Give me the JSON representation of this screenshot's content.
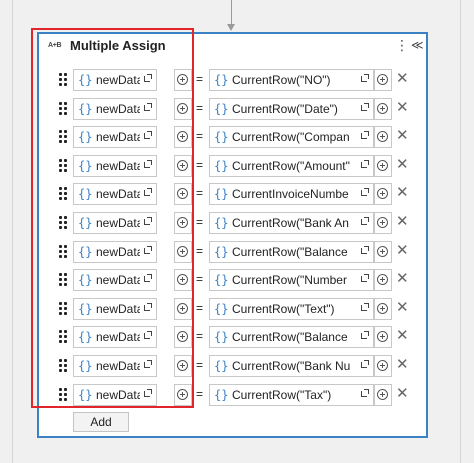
{
  "activity": {
    "icon_text": "A+B",
    "title": "Multiple Assign",
    "menu_icon": "⋮",
    "collapse_icon": "≪"
  },
  "brace_glyph": "{}",
  "equals_glyph": "=",
  "remove_glyph": "✕",
  "rows": [
    {
      "left": "newDataR",
      "right": "CurrentRow(\"NO\")"
    },
    {
      "left": "newDataR",
      "right": "CurrentRow(\"Date\")"
    },
    {
      "left": "newDataR",
      "right": "CurrentRow(\"Compan"
    },
    {
      "left": "newDataR",
      "right": "CurrentRow(\"Amount\""
    },
    {
      "left": "newDataR",
      "right": "CurrentInvoiceNumbe"
    },
    {
      "left": "newDataR",
      "right": "CurrentRow(\"Bank An"
    },
    {
      "left": "newDataR",
      "right": "CurrentRow(\"Balance"
    },
    {
      "left": "newDataR",
      "right": "CurrentRow(\"Number"
    },
    {
      "left": "newDataR",
      "right": "CurrentRow(\"Text\")"
    },
    {
      "left": "newDataR",
      "right": "CurrentRow(\"Balance"
    },
    {
      "left": "newDataR",
      "right": "CurrentRow(\"Bank Nu"
    },
    {
      "left": "newDataR",
      "right": "CurrentRow(\"Tax\")"
    }
  ],
  "add_label": "Add",
  "colors": {
    "accent": "#3b82c4",
    "highlight": "#e0262a"
  }
}
